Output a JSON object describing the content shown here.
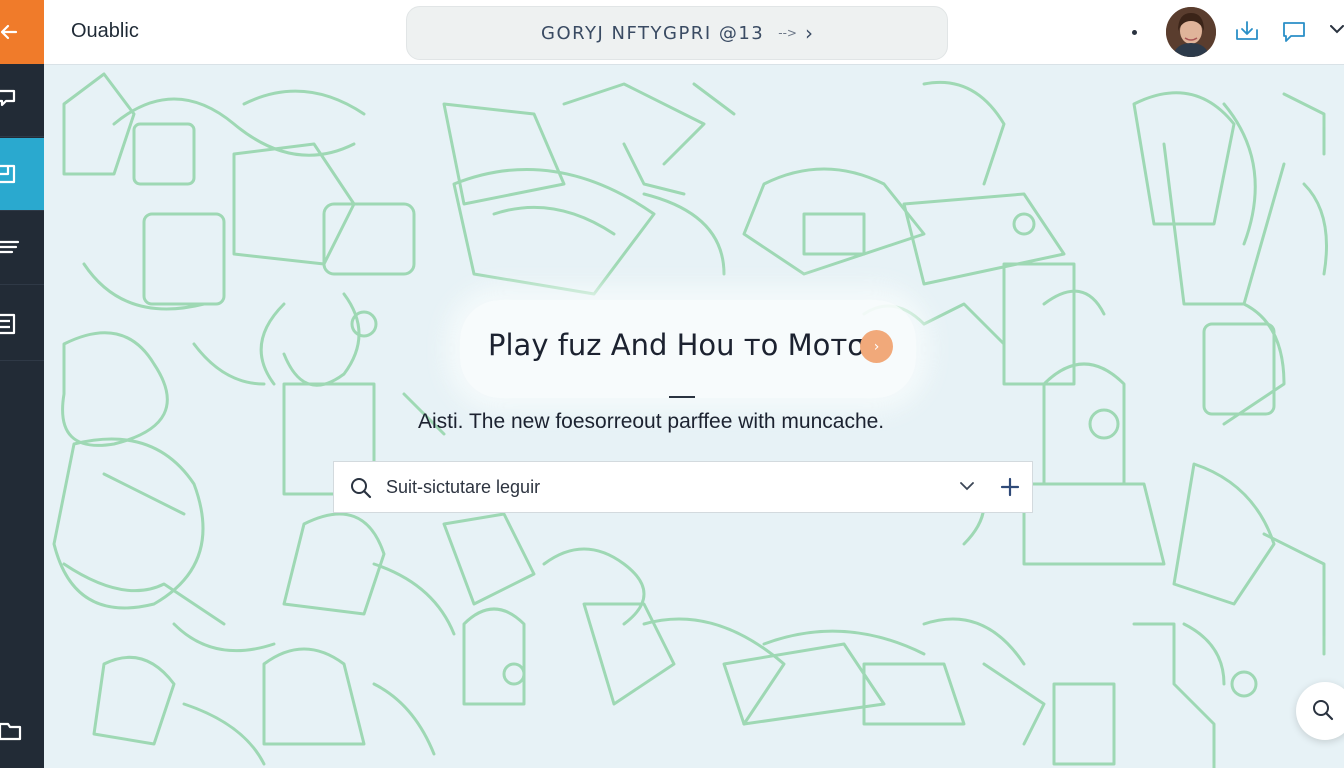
{
  "app": {
    "title": "Ouablic"
  },
  "header": {
    "breadcrumb": "GORYJ NFTYGPRI @13",
    "breadcrumb_arrow": "-->",
    "breadcrumb_chevron": "›"
  },
  "sidebar": {
    "items": [
      {
        "icon": "back-arrow-icon",
        "active": false
      },
      {
        "icon": "pin-icon",
        "active": false
      },
      {
        "icon": "layout-icon",
        "active": true
      },
      {
        "icon": "layers-icon",
        "active": false
      },
      {
        "icon": "list-icon",
        "active": false
      },
      {
        "icon": "folder-icon",
        "active": false
      }
    ]
  },
  "toolbar": {
    "icons": [
      "dot-menu-icon",
      "avatar",
      "download-icon",
      "chat-icon",
      "chevron-down-icon"
    ]
  },
  "hero": {
    "title": "Play fuz And Hou то Мотσ",
    "subtitle": "Aisti. The new foesorreout parffee with muncache."
  },
  "search": {
    "value": "Suit-sictutare leguir"
  },
  "colors": {
    "accent_orange": "#f07b2a",
    "active_blue": "#2aa9cf",
    "rail_dark": "#222b36",
    "doodle_green": "#8fd3a8",
    "background": "#e7f2f6"
  }
}
